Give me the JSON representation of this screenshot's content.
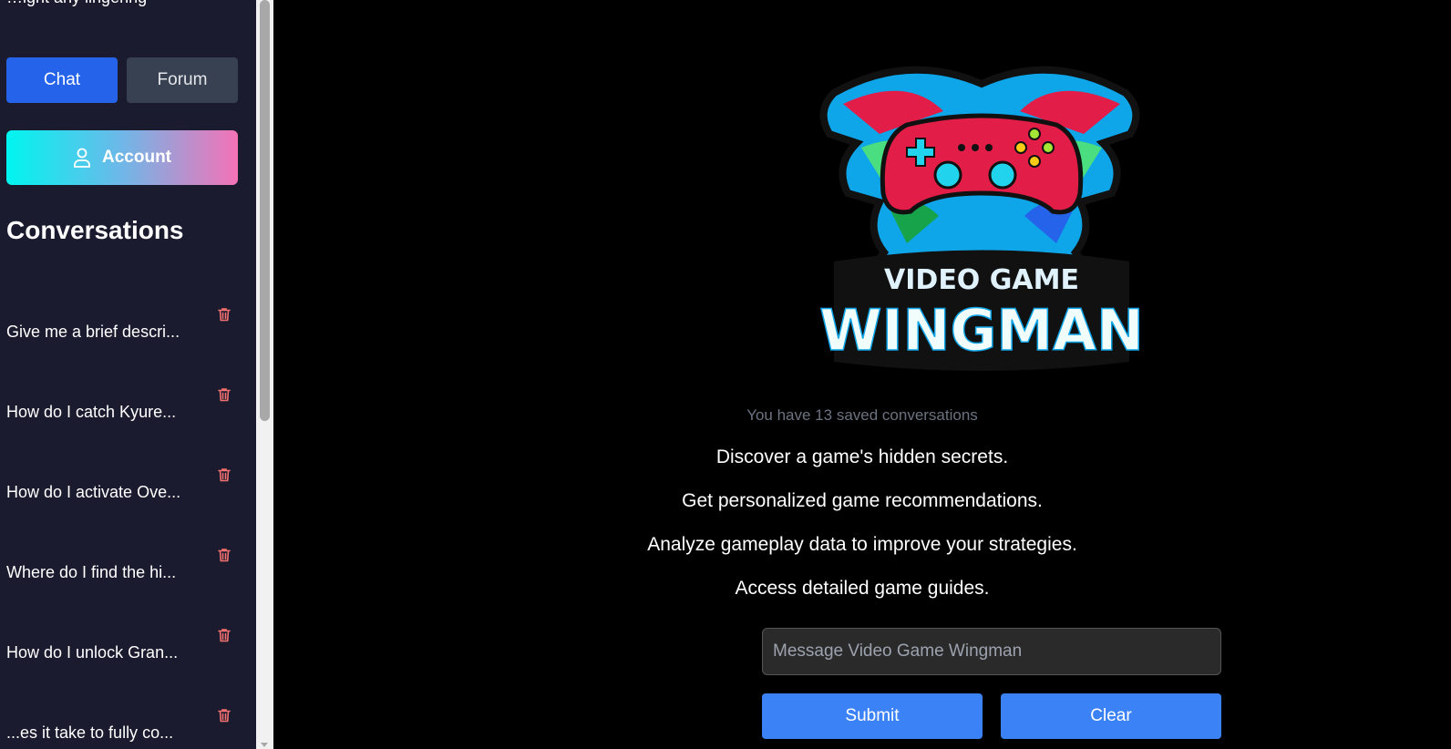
{
  "sidebar": {
    "cut_text": "…ight any lingering",
    "chat_label": "Chat",
    "forum_label": "Forum",
    "account_label": "Account",
    "conversations_title": "Conversations",
    "conversations": [
      {
        "title": "Give me a brief descri..."
      },
      {
        "title": "How do I catch Kyure..."
      },
      {
        "title": "How do I activate Ove..."
      },
      {
        "title": "Where do I find the hi..."
      },
      {
        "title": "How do I unlock Gran..."
      },
      {
        "title": "...es it take to fully co..."
      }
    ]
  },
  "main": {
    "logo": {
      "line1": "VIDEO GAME",
      "line2": "WINGMAN"
    },
    "saved_text": "You have 13 saved conversations",
    "taglines": [
      "Discover a game's hidden secrets.",
      "Get personalized game recommendations.",
      "Analyze gameplay data to improve your strategies.",
      "Access detailed game guides."
    ],
    "input_placeholder": "Message Video Game Wingman",
    "submit_label": "Submit",
    "clear_label": "Clear"
  },
  "colors": {
    "chat_button": "#2563eb",
    "forum_button": "#374151",
    "action_button": "#3b82f6",
    "trash_icon": "#f87171",
    "sidebar_bg": "#1a1b2e"
  }
}
